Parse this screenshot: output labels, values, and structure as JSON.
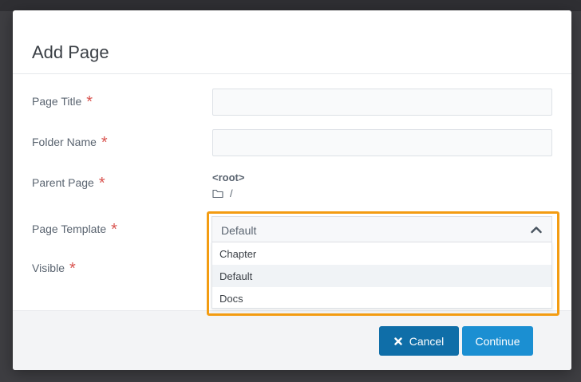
{
  "dialog": {
    "title": "Add Page"
  },
  "form": {
    "required_mark": "*",
    "page_title": {
      "label": "Page Title",
      "value": ""
    },
    "folder_name": {
      "label": "Folder Name",
      "value": ""
    },
    "parent_page": {
      "label": "Parent Page",
      "value": "<root>",
      "path": "/"
    },
    "page_template": {
      "label": "Page Template",
      "selected": "Default",
      "options": [
        "Chapter",
        "Default",
        "Docs"
      ]
    },
    "visible": {
      "label": "Visible"
    }
  },
  "footer": {
    "cancel_label": "Cancel",
    "continue_label": "Continue"
  },
  "icons": {
    "folder": "folder-icon",
    "close": "close-icon",
    "chevron": "chevron-up-icon"
  },
  "colors": {
    "required": "#d9534f",
    "highlight": "#f39c12",
    "cancel_button": "#0f6ea8",
    "continue_button": "#1b8fd2"
  }
}
